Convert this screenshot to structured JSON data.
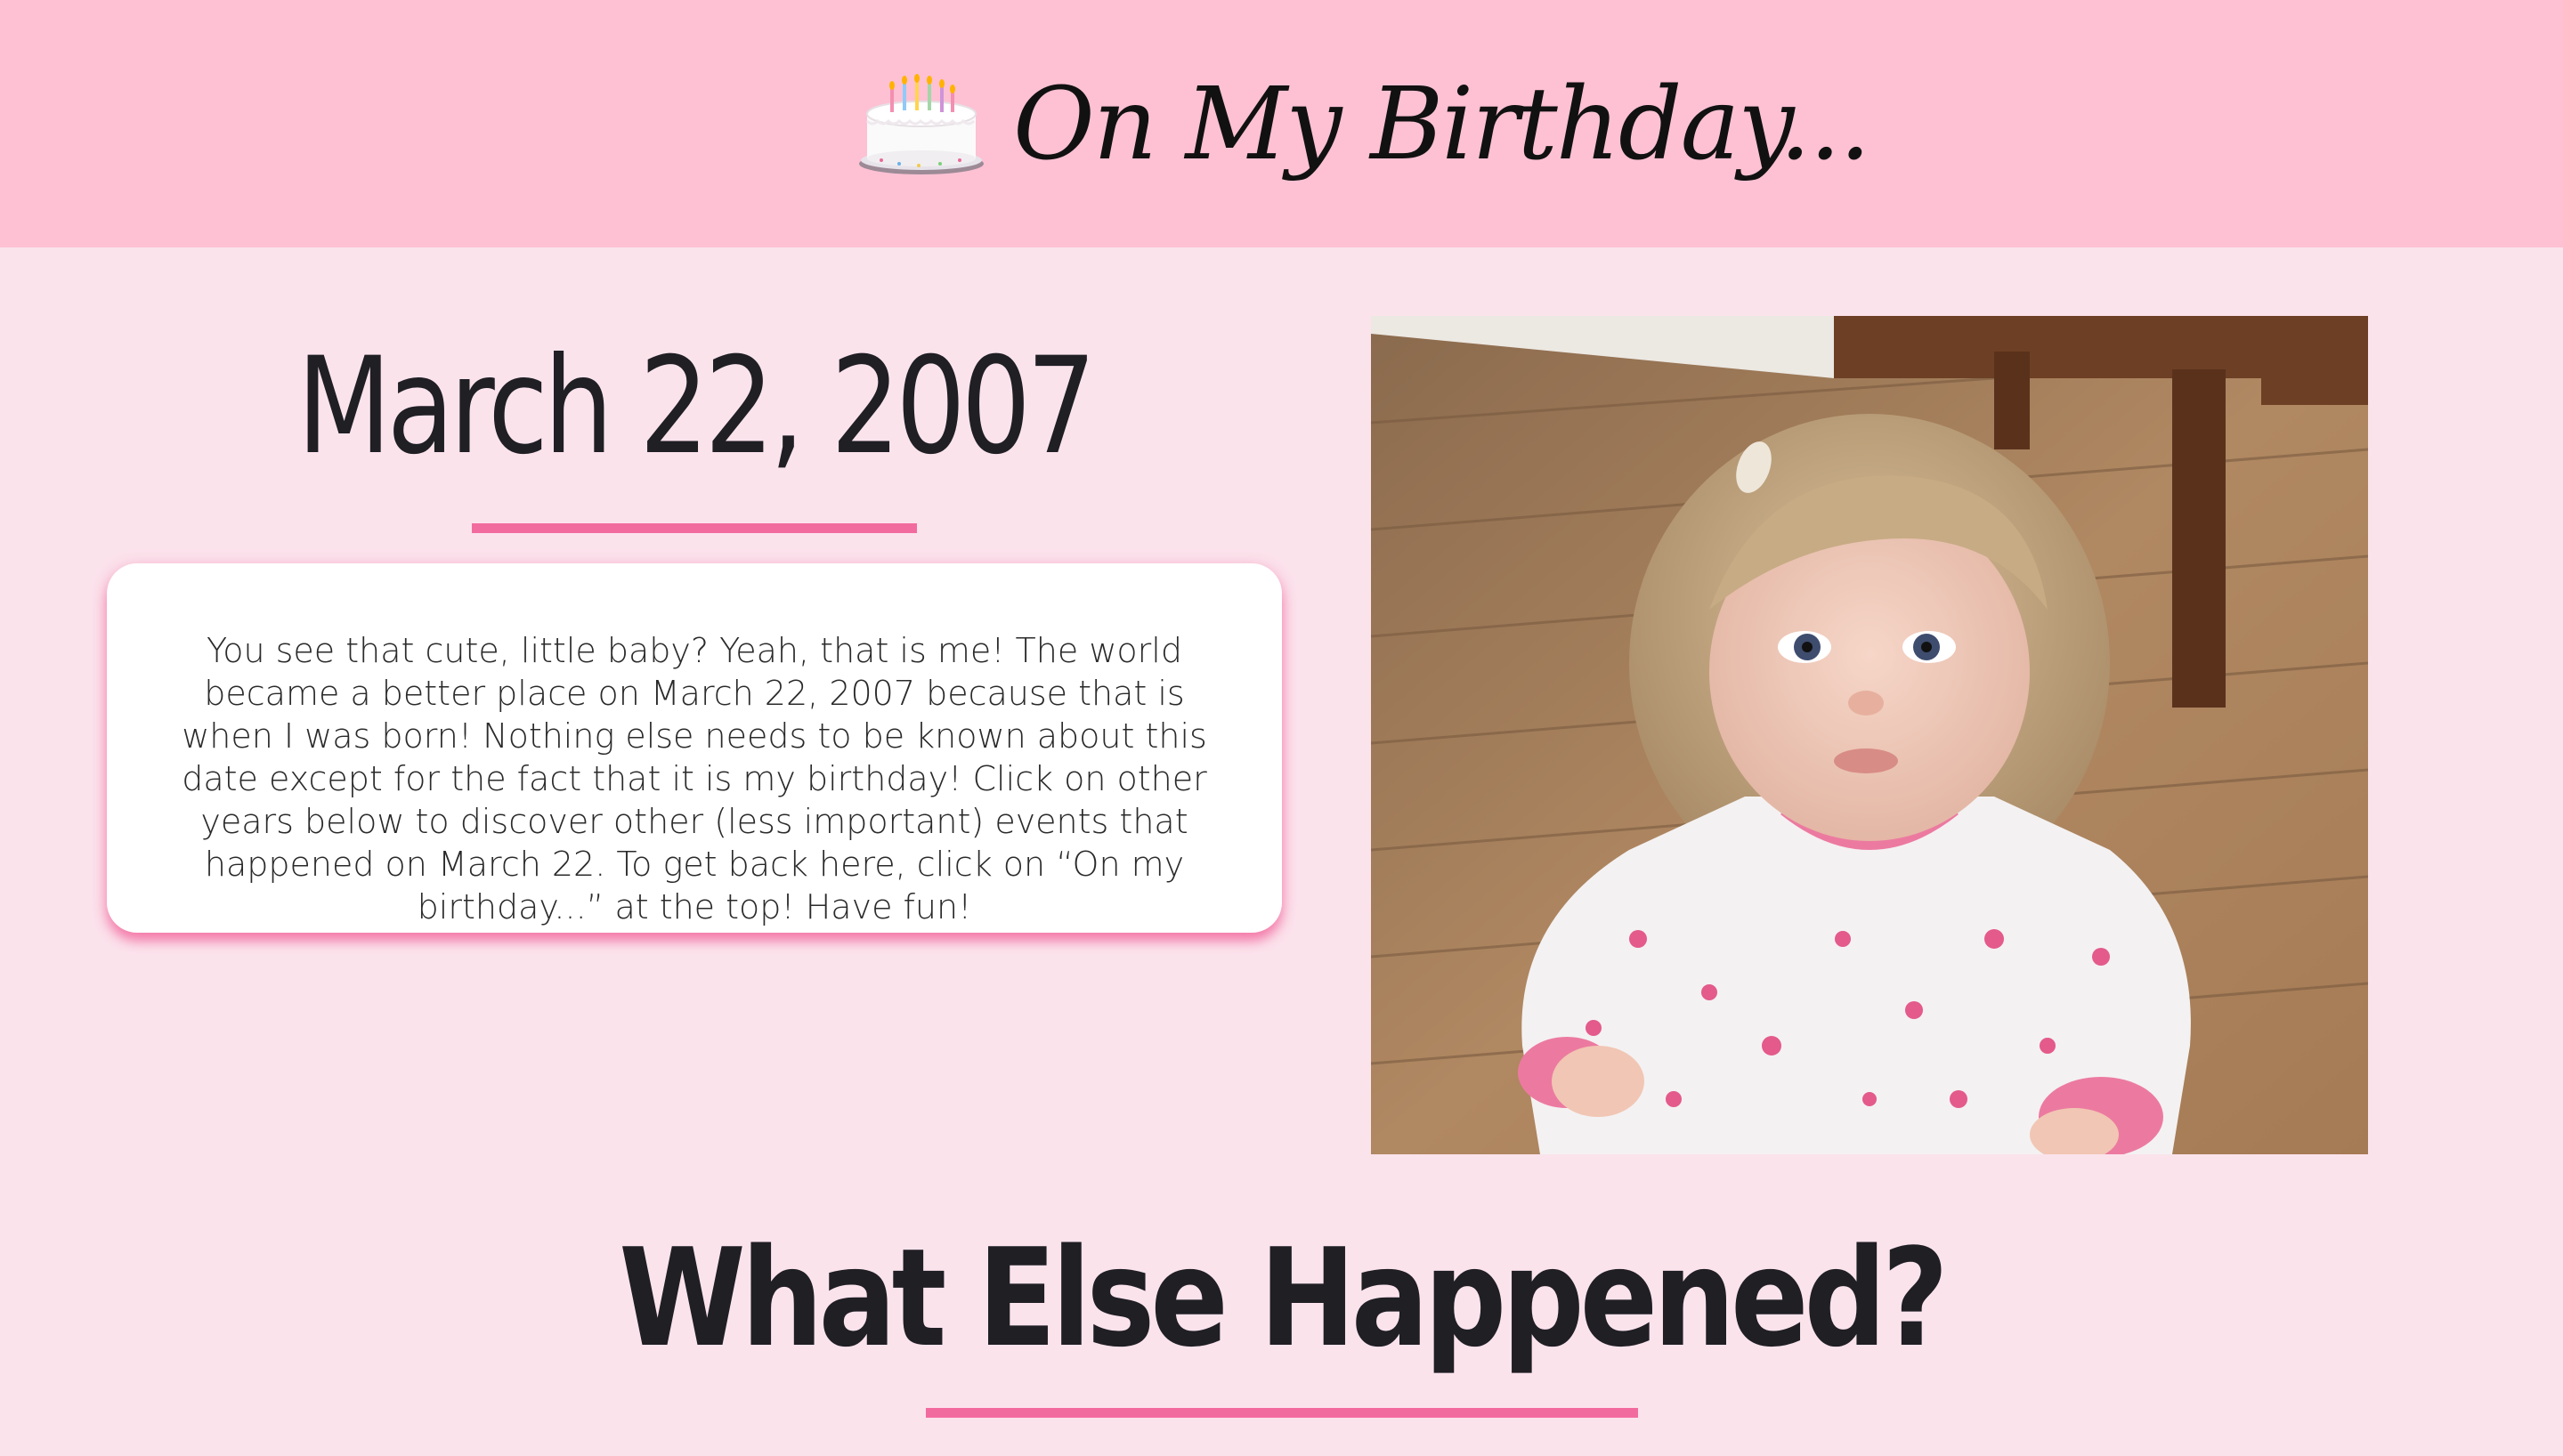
{
  "header": {
    "title": "On My Birthday...",
    "icon": "birthday-cake-icon",
    "background_color": "#fdc1d3"
  },
  "intro": {
    "date": "March 22, 2007",
    "text": "You see that cute, little baby? Yeah, that is me! The world became a better place on March 22, 2007 because that is when I was born! Nothing else needs to be known about this date except for the fact that it is my birthday! Click on other years below to discover other (less important) events that happened on March 22. To get back here, click on “On my birthday...” at the top! Have fun!"
  },
  "photo": {
    "subject": "baby-photo"
  },
  "section": {
    "heading": "What Else Happened?"
  },
  "colors": {
    "page_background": "#fbe3ec",
    "accent": "#f26b9e",
    "heading_text": "#1f1f24"
  }
}
